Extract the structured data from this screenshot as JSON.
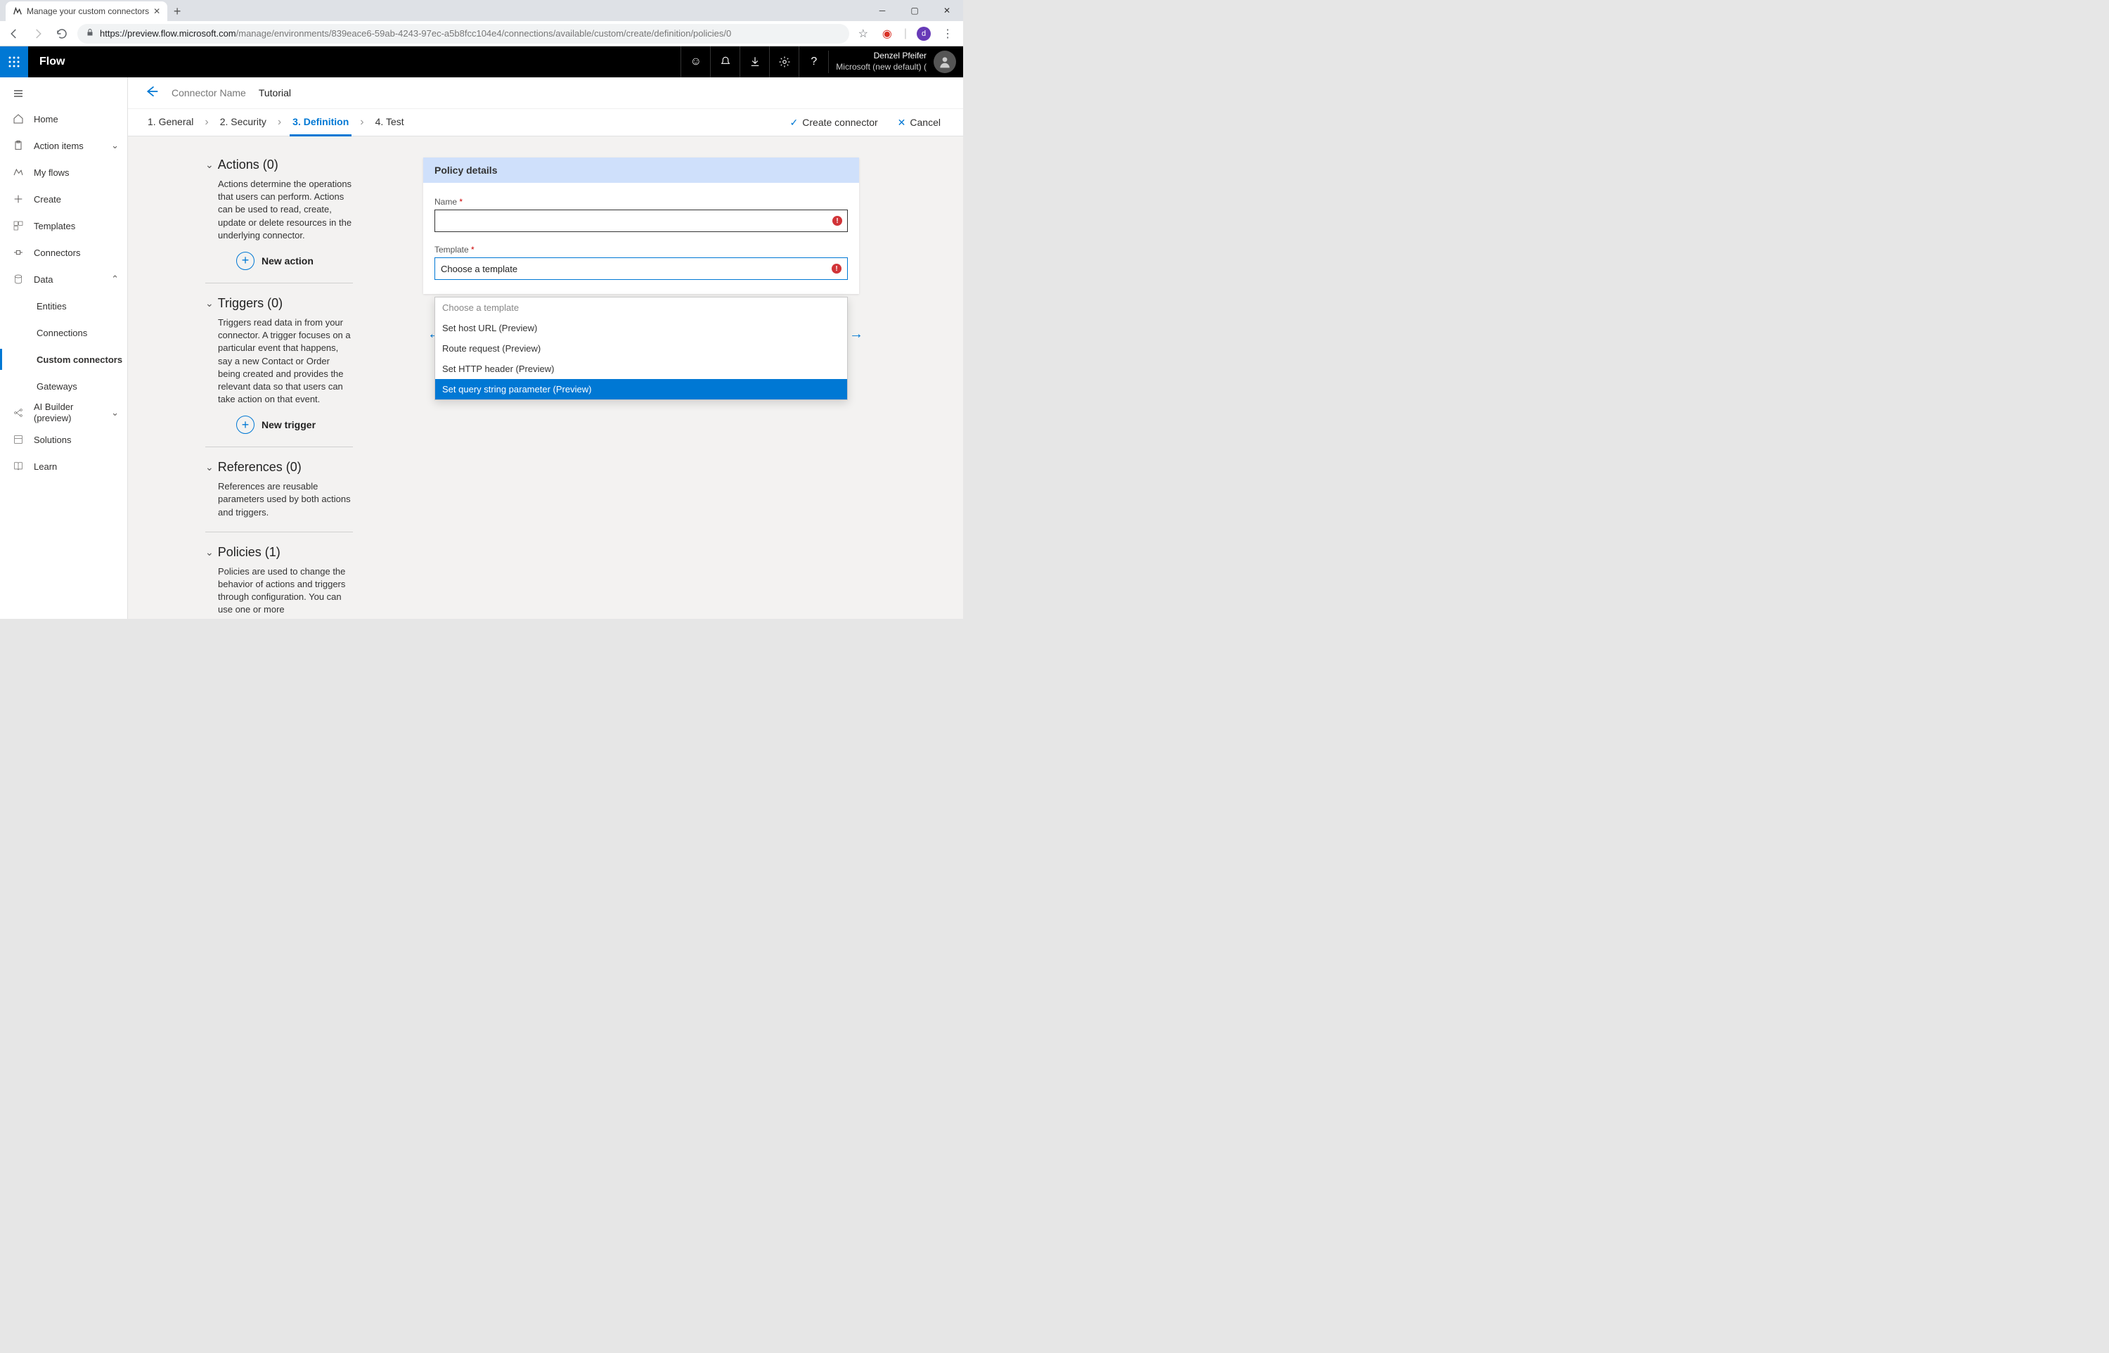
{
  "browser": {
    "tab_title": "Manage your custom connectors",
    "url_host": "https://preview.flow.microsoft.com",
    "url_path": "/manage/environments/839eace6-59ab-4243-97ec-a5b8fcc104e4/connections/available/custom/create/definition/policies/0",
    "avatar_letter": "d"
  },
  "header": {
    "brand": "Flow",
    "user_name": "Denzel Pfeifer",
    "tenant": "Microsoft (new default) ("
  },
  "sidebar": {
    "home": "Home",
    "action_items": "Action items",
    "my_flows": "My flows",
    "create": "Create",
    "templates": "Templates",
    "connectors": "Connectors",
    "data": "Data",
    "entities": "Entities",
    "connections": "Connections",
    "custom_connectors": "Custom connectors",
    "gateways": "Gateways",
    "ai_builder": "AI Builder (preview)",
    "solutions": "Solutions",
    "learn": "Learn"
  },
  "titlebar": {
    "label": "Connector Name",
    "name": "Tutorial"
  },
  "steps": {
    "s1": "1. General",
    "s2": "2. Security",
    "s3": "3. Definition",
    "s4": "4. Test",
    "create": "Create connector",
    "cancel": "Cancel"
  },
  "sections": {
    "actions_title": "Actions (0)",
    "actions_desc": "Actions determine the operations that users can perform. Actions can be used to read, create, update or delete resources in the underlying connector.",
    "actions_add": "New action",
    "triggers_title": "Triggers (0)",
    "triggers_desc": "Triggers read data in from your connector. A trigger focuses on a particular event that happens, say a new Contact or Order being created and provides the relevant data so that users can take action on that event.",
    "triggers_add": "New trigger",
    "references_title": "References (0)",
    "references_desc": "References are reusable parameters used by both actions and triggers.",
    "policies_title": "Policies (1)",
    "policies_desc": "Policies are used to change the behavior of actions and triggers through configuration. You can use one or more"
  },
  "panel": {
    "title": "Policy details",
    "name_label": "Name",
    "template_label": "Template",
    "template_value": "Choose a template",
    "options": {
      "o0": "Choose a template",
      "o1": "Set host URL (Preview)",
      "o2": "Route request (Preview)",
      "o3": "Set HTTP header (Preview)",
      "o4": "Set query string parameter (Preview)"
    }
  }
}
